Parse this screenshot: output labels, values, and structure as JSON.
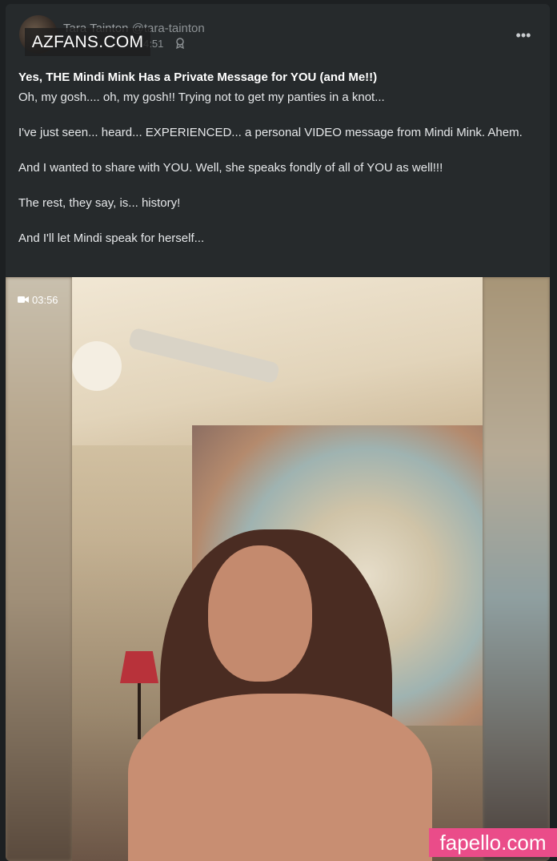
{
  "post": {
    "author": {
      "display_name": "Tara Tainton",
      "handle": "@tara-tainton"
    },
    "time": "4:51",
    "title": "Yes, THE Mindi Mink Has a Private Message for YOU (and Me!!)",
    "paragraphs": [
      "Oh, my gosh.... oh, my gosh!! Trying not to get my panties in a knot...",
      "I've just seen... heard... EXPERIENCED... a personal VIDEO message from Mindi Mink. Ahem.",
      "And I wanted to share with YOU. Well, she speaks fondly of all of YOU as well!!!",
      "The rest, they say, is... history!",
      "And I'll let Mindi speak for herself..."
    ],
    "video": {
      "duration": "03:56",
      "icon": "video-camera-icon"
    },
    "menu_icon": "more-horizontal-icon",
    "badge_icon": "award-icon"
  },
  "watermarks": {
    "top": "AZFANS.COM",
    "bottom": "fapello.com"
  },
  "colors": {
    "background": "#1d2022",
    "card": "#262a2c",
    "text": "#e6e8ea",
    "muted": "#8d9295",
    "watermark_bottom": "#ea4c89"
  }
}
